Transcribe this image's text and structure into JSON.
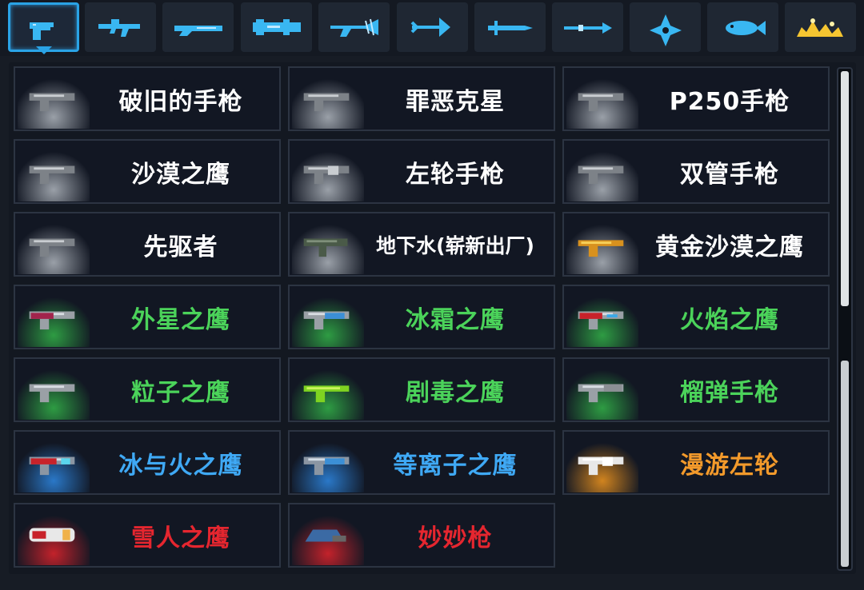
{
  "colors": {
    "accent": "#2aa3e6",
    "tier_white": "#ffffff",
    "tier_green": "#4bd35a",
    "tier_blue": "#3fa9f5",
    "tier_orange": "#f39a2b",
    "tier_red": "#e5262f"
  },
  "tabs": [
    {
      "icon": "pistol-category-icon",
      "active": true
    },
    {
      "icon": "assault-rifle-category-icon",
      "active": false
    },
    {
      "icon": "shotgun-category-icon",
      "active": false
    },
    {
      "icon": "rocket-launcher-category-icon",
      "active": false
    },
    {
      "icon": "laser-rifle-category-icon",
      "active": false
    },
    {
      "icon": "bow-category-icon",
      "active": false
    },
    {
      "icon": "sword-category-icon",
      "active": false
    },
    {
      "icon": "spear-category-icon",
      "active": false
    },
    {
      "icon": "shuriken-category-icon",
      "active": false
    },
    {
      "icon": "fish-category-icon",
      "active": false
    },
    {
      "icon": "special-gold-category-icon",
      "active": false
    }
  ],
  "weapons": [
    {
      "name": "破旧的手枪",
      "tier": "white",
      "icon": "old-pistol-icon",
      "glow": "#9aa0a8"
    },
    {
      "name": "罪恶克星",
      "tier": "white",
      "icon": "nemesis-pistol-icon",
      "glow": "#9aa0a8"
    },
    {
      "name": "P250手枪",
      "tier": "white",
      "icon": "p250-pistol-icon",
      "glow": "#9aa0a8"
    },
    {
      "name": "沙漠之鹰",
      "tier": "white",
      "icon": "desert-eagle-icon",
      "glow": "#9aa0a8"
    },
    {
      "name": "左轮手枪",
      "tier": "white",
      "icon": "revolver-icon",
      "glow": "#9aa0a8"
    },
    {
      "name": "双管手枪",
      "tier": "white",
      "icon": "double-barrel-pistol-icon",
      "glow": "#9aa0a8"
    },
    {
      "name": "先驱者",
      "tier": "white",
      "icon": "pioneer-pistol-icon",
      "glow": "#9aa0a8"
    },
    {
      "name": "地下水(崭新出厂)",
      "tier": "white",
      "icon": "smg-icon",
      "glow": "#9aa0a8",
      "small": true
    },
    {
      "name": "黄金沙漠之鹰",
      "tier": "white",
      "icon": "golden-desert-eagle-icon",
      "glow": "#9aa0a8"
    },
    {
      "name": "外星之鹰",
      "tier": "green",
      "icon": "alien-eagle-icon",
      "glow": "#2e9c43"
    },
    {
      "name": "冰霜之鹰",
      "tier": "green",
      "icon": "frost-eagle-icon",
      "glow": "#2e9c43"
    },
    {
      "name": "火焰之鹰",
      "tier": "green",
      "icon": "flame-eagle-icon",
      "glow": "#2e9c43"
    },
    {
      "name": "粒子之鹰",
      "tier": "green",
      "icon": "particle-eagle-icon",
      "glow": "#2e9c43"
    },
    {
      "name": "剧毒之鹰",
      "tier": "green",
      "icon": "toxic-eagle-icon",
      "glow": "#2e9c43"
    },
    {
      "name": "榴弹手枪",
      "tier": "green",
      "icon": "grenade-pistol-icon",
      "glow": "#2e9c43"
    },
    {
      "name": "冰与火之鹰",
      "tier": "blue",
      "icon": "ice-fire-eagle-icon",
      "glow": "#2a78c8"
    },
    {
      "name": "等离子之鹰",
      "tier": "blue",
      "icon": "plasma-eagle-icon",
      "glow": "#2a78c8"
    },
    {
      "name": "漫游左轮",
      "tier": "orange",
      "icon": "roaming-revolver-icon",
      "glow": "#d1841f"
    },
    {
      "name": "雪人之鹰",
      "tier": "red",
      "icon": "snowman-eagle-icon",
      "glow": "#c3222b"
    },
    {
      "name": "妙妙枪",
      "tier": "red",
      "icon": "miaomiao-gun-icon",
      "glow": "#c3222b"
    }
  ]
}
